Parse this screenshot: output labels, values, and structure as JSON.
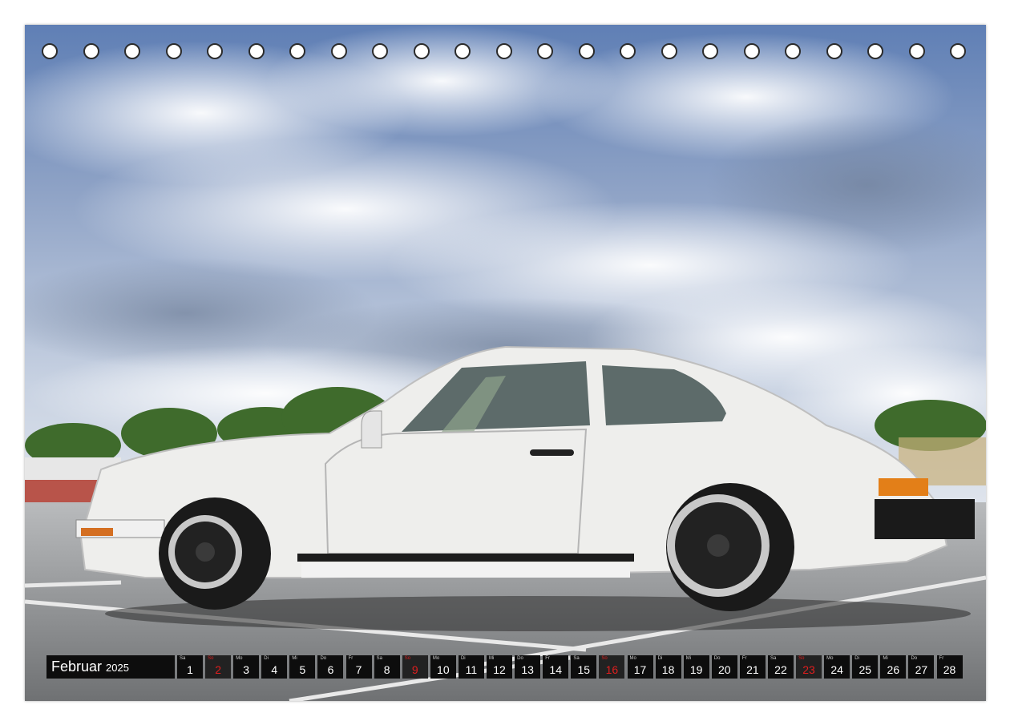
{
  "calendar": {
    "month": "Februar",
    "year": "2025",
    "accent_sunday": "#e01e1e",
    "days": [
      {
        "wd": "Sa",
        "num": "1",
        "sunday": false
      },
      {
        "wd": "So",
        "num": "2",
        "sunday": true
      },
      {
        "wd": "Mo",
        "num": "3",
        "sunday": false
      },
      {
        "wd": "Di",
        "num": "4",
        "sunday": false
      },
      {
        "wd": "Mi",
        "num": "5",
        "sunday": false
      },
      {
        "wd": "Do",
        "num": "6",
        "sunday": false
      },
      {
        "wd": "Fr",
        "num": "7",
        "sunday": false
      },
      {
        "wd": "Sa",
        "num": "8",
        "sunday": false
      },
      {
        "wd": "So",
        "num": "9",
        "sunday": true
      },
      {
        "wd": "Mo",
        "num": "10",
        "sunday": false
      },
      {
        "wd": "Di",
        "num": "11",
        "sunday": false
      },
      {
        "wd": "Mi",
        "num": "12",
        "sunday": false
      },
      {
        "wd": "Do",
        "num": "13",
        "sunday": false
      },
      {
        "wd": "Fr",
        "num": "14",
        "sunday": false
      },
      {
        "wd": "Sa",
        "num": "15",
        "sunday": false
      },
      {
        "wd": "So",
        "num": "16",
        "sunday": true
      },
      {
        "wd": "Mo",
        "num": "17",
        "sunday": false
      },
      {
        "wd": "Di",
        "num": "18",
        "sunday": false
      },
      {
        "wd": "Mi",
        "num": "19",
        "sunday": false
      },
      {
        "wd": "Do",
        "num": "20",
        "sunday": false
      },
      {
        "wd": "Fr",
        "num": "21",
        "sunday": false
      },
      {
        "wd": "Sa",
        "num": "22",
        "sunday": false
      },
      {
        "wd": "So",
        "num": "23",
        "sunday": true
      },
      {
        "wd": "Mo",
        "num": "24",
        "sunday": false
      },
      {
        "wd": "Di",
        "num": "25",
        "sunday": false
      },
      {
        "wd": "Mi",
        "num": "26",
        "sunday": false
      },
      {
        "wd": "Do",
        "num": "27",
        "sunday": false
      },
      {
        "wd": "Fr",
        "num": "28",
        "sunday": false
      }
    ]
  },
  "binding": {
    "hole_count": 23
  },
  "photo": {
    "subject": "white-sports-car-icon"
  }
}
